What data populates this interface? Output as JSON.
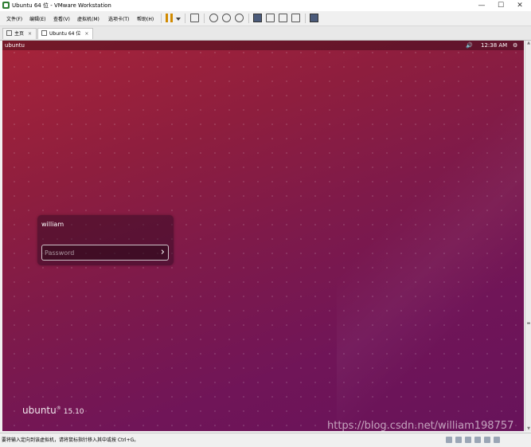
{
  "window": {
    "title": "Ubuntu 64 位 - VMware Workstation"
  },
  "window_controls": {
    "minimize": "—",
    "maximize": "☐",
    "close": "✕"
  },
  "menu": [
    "文件(F)",
    "编辑(E)",
    "查看(V)",
    "虚拟机(M)",
    "选项卡(T)",
    "帮助(H)"
  ],
  "toolbar": {
    "icons": [
      "pause-icon",
      "dropdown-caret-icon",
      "send-ctrl-alt-del-icon",
      "snapshot-icon",
      "revert-snapshot-icon",
      "snapshot-manager-icon",
      "library-icon",
      "console-view-icon",
      "full-screen-icon",
      "unity-icon",
      "thumbnail-view-icon"
    ]
  },
  "tabs": [
    {
      "label": "主页",
      "icon": "home-icon",
      "closable": true,
      "active": false
    },
    {
      "label": "Ubuntu 64 位",
      "icon": "vm-icon",
      "closable": true,
      "active": true
    }
  ],
  "vm": {
    "topbar": {
      "hostname": "ubuntu",
      "volume_icon": "🔊",
      "time": "12:38 AM",
      "gear_icon": "⚙"
    },
    "login": {
      "username": "william",
      "password_placeholder": "Password",
      "submit_arrow": "›"
    },
    "logo": {
      "name": "ubuntu",
      "mark": "®",
      "version": "15.10"
    },
    "watermark": "https://blog.csdn.net/william198757"
  },
  "status": {
    "text": "要将输入定向到该虚拟机，请将鼠标指针移入其中或按 Ctrl+G。"
  },
  "colors": {
    "desktop_top": "#a7243a",
    "desktop_bottom": "#67135a",
    "pause_accent": "#d18a00"
  }
}
